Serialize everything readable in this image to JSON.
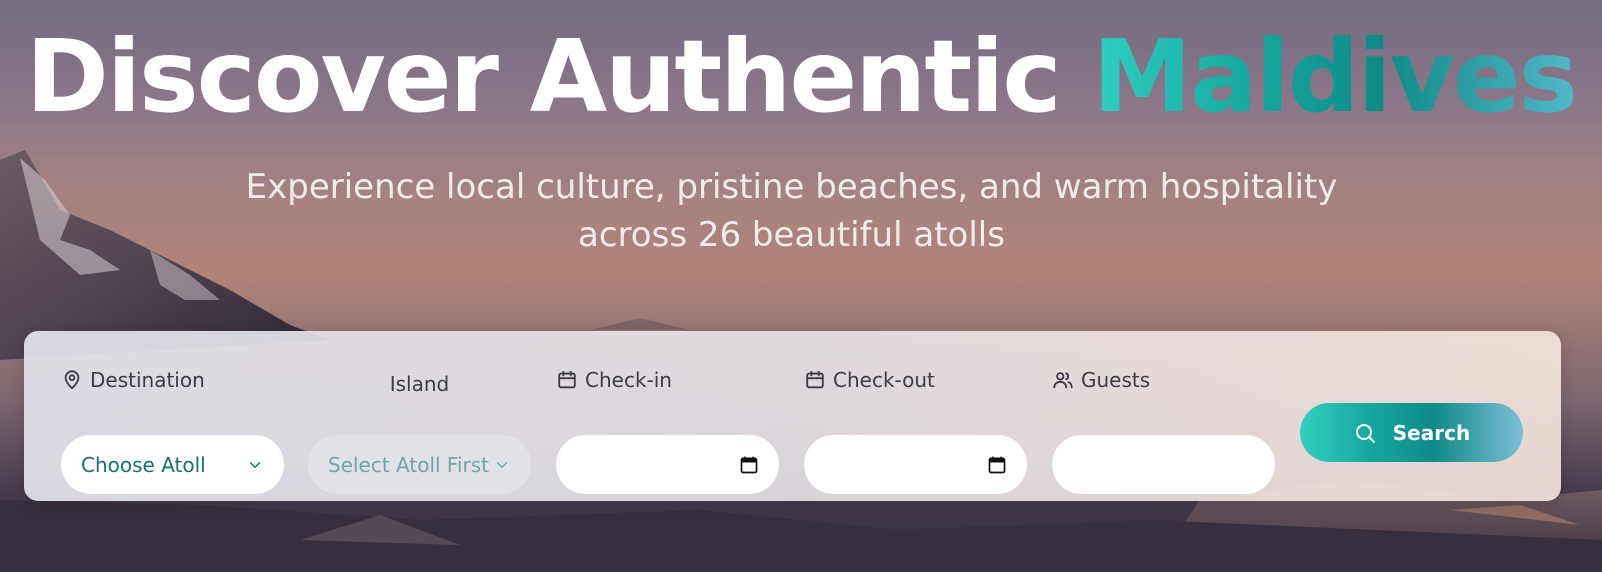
{
  "hero": {
    "title_main": "Discover Authentic ",
    "title_accent": "Maldives",
    "subtitle_line1": "Experience local culture, pristine beaches, and warm hospitality",
    "subtitle_line2": "across 26 beautiful atolls"
  },
  "search": {
    "destination": {
      "label": "Destination",
      "value": "Choose Atoll",
      "icon": "map-pin-icon"
    },
    "island": {
      "label": "Island",
      "value": "Select Atoll First",
      "icon": "chevron-down-icon"
    },
    "checkin": {
      "label": "Check-in",
      "value": "",
      "icon": "calendar-icon"
    },
    "checkout": {
      "label": "Check-out",
      "value": "",
      "icon": "calendar-icon"
    },
    "guests": {
      "label": "Guests",
      "value": "",
      "icon": "users-icon"
    },
    "button": {
      "label": "Search",
      "icon": "search-icon"
    }
  },
  "colors": {
    "accent_start": "#2fcfc0",
    "accent_end": "#52b8c8",
    "select_text": "#15726c"
  }
}
